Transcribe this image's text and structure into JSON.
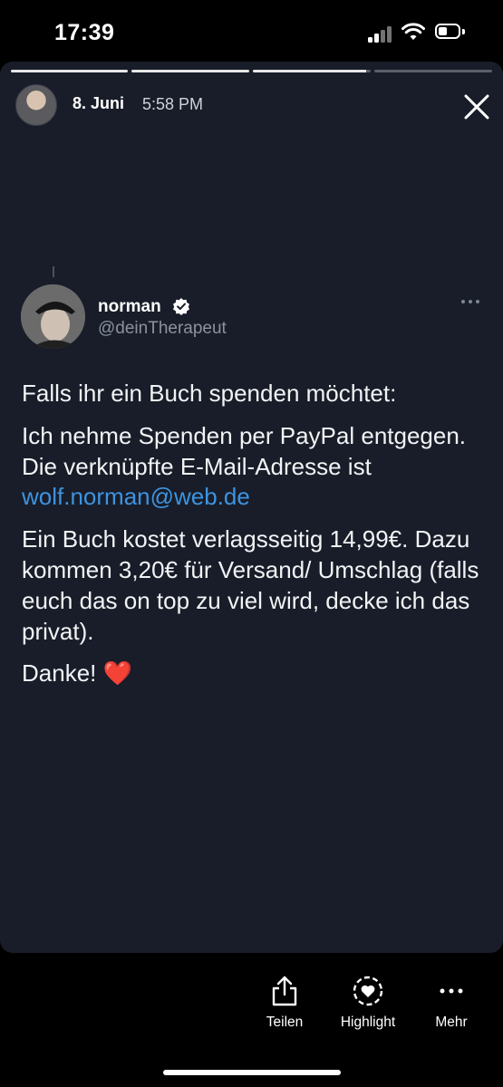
{
  "status_bar": {
    "time": "17:39"
  },
  "story": {
    "progress": [
      1,
      1,
      0.96,
      0
    ],
    "date": "8. Juni",
    "time": "5:58 PM"
  },
  "tweet": {
    "name": "norman",
    "handle": "@deinTherapeut",
    "paragraph1": "Falls ihr ein Buch spenden möchtet:",
    "paragraph2_text": "Ich nehme Spenden per PayPal entgegen. Die verknüpfte E-Mail-Adresse ist ",
    "paragraph2_link": "wolf.norman@web.de",
    "paragraph3": "Ein Buch kostet verlagsseitig 14,99€. Dazu kommen 3,20€ für Versand/ Umschlag (falls euch das on top zu viel wird, decke ich das privat).",
    "paragraph4_text": "Danke! ",
    "paragraph4_emoji": "❤️"
  },
  "actions": {
    "share_label": "Teilen",
    "highlight_label": "Highlight",
    "more_label": "Mehr"
  },
  "colors": {
    "card_bg": "#181d29",
    "link": "#3e93e0",
    "verified": "#ffffff"
  },
  "icons": [
    "signal-icon",
    "wifi-icon",
    "battery-icon",
    "close-icon",
    "verified-badge-icon",
    "more-dots-icon",
    "share-icon",
    "highlight-heart-icon",
    "more-icon"
  ]
}
